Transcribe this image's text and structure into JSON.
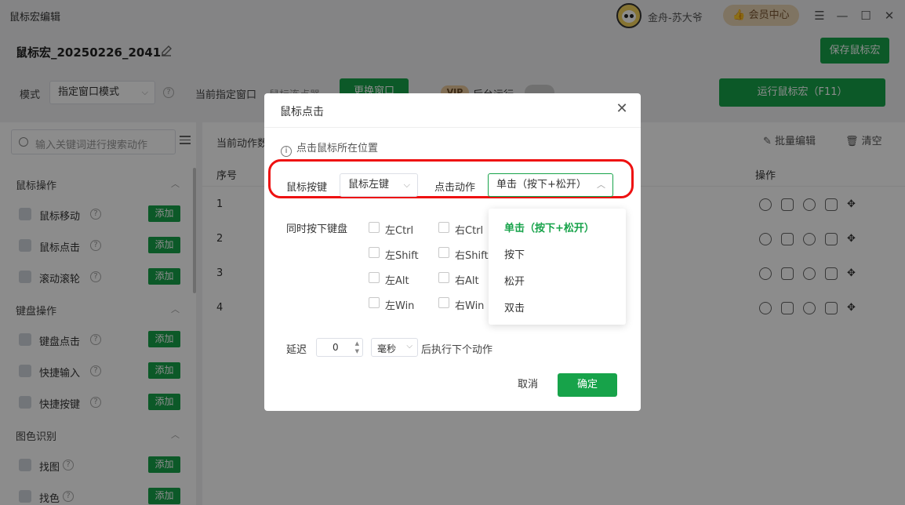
{
  "app": {
    "title": "鼠标宏编辑",
    "user_name": "金舟-苏大爷",
    "vip_label": "会员中心"
  },
  "header": {
    "macro_name": "鼠标宏_20250226_2041",
    "save_label": "保存鼠标宏"
  },
  "mode_bar": {
    "mode_label": "模式",
    "mode_value": "指定窗口模式",
    "current_window_label": "当前指定窗口",
    "current_window_value": "鼠标连点器",
    "switch_label": "更换窗口",
    "vip_tag": "VIP",
    "background_run_label": "后台运行",
    "run_label": "运行鼠标宏（F11）"
  },
  "sidebar": {
    "search_placeholder": "输入关键词进行搜索动作",
    "add_label": "添加",
    "categories": [
      {
        "name": "鼠标操作",
        "items": [
          "鼠标移动",
          "鼠标点击",
          "滚动滚轮"
        ]
      },
      {
        "name": "键盘操作",
        "items": [
          "键盘点击",
          "快捷输入",
          "快捷按键"
        ]
      },
      {
        "name": "图色识别",
        "items": [
          "找图",
          "找色"
        ]
      }
    ]
  },
  "main": {
    "current_actions_label": "当前动作数",
    "batch_edit_label": "批量编辑",
    "clear_label": "清空",
    "col_index": "序号",
    "col_ops": "操作",
    "rows": [
      "1",
      "2",
      "3",
      "4"
    ]
  },
  "dialog": {
    "title": "鼠标点击",
    "info_text": "点击鼠标所在位置",
    "mouse_button_label": "鼠标按键",
    "mouse_button_value": "鼠标左键",
    "click_action_label": "点击动作",
    "click_action_value": "单击（按下+松开）",
    "keyboard_label": "同时按下键盘",
    "modifiers": [
      "左Ctrl",
      "右Ctrl",
      "左Shift",
      "右Shift",
      "左Alt",
      "右Alt",
      "左Win",
      "右Win"
    ],
    "delay_label": "延迟",
    "delay_value": "0",
    "delay_unit": "毫秒",
    "after_label": "后执行下个动作",
    "cancel_label": "取消",
    "ok_label": "确定"
  },
  "dropdown": {
    "options": [
      "单击（按下+松开）",
      "按下",
      "松开",
      "双击"
    ],
    "selected_index": 0
  },
  "colors": {
    "accent": "#17a34a",
    "highlight_border": "#e11111",
    "vip": "#e8d3b3"
  }
}
